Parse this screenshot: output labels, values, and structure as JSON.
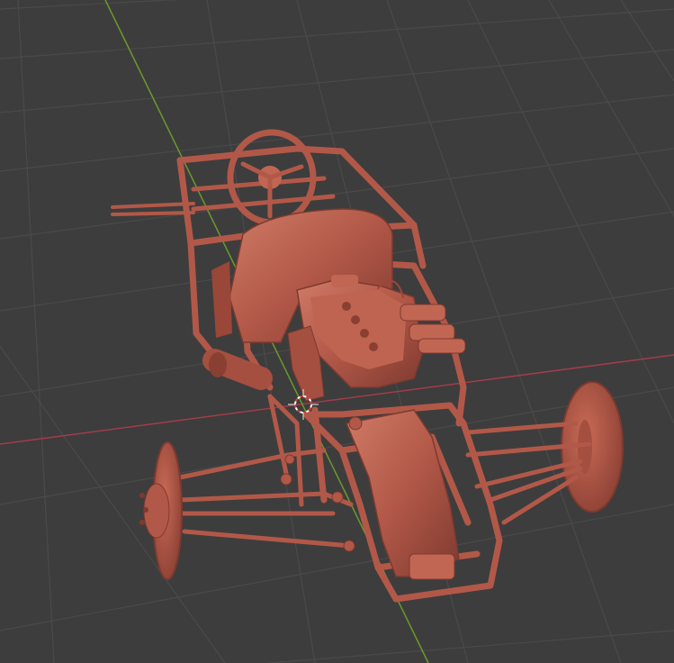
{
  "viewport": {
    "background": "#3d3d3d",
    "grid_color": "#4a4a4a",
    "x_axis_color": "#a23d4a",
    "y_axis_color": "#6a9a2a",
    "model_color": "#b25848",
    "model_shadow": "#7e3a2f",
    "model_highlight": "#cf7a66",
    "cursor_icon": "3d-cursor-icon"
  }
}
